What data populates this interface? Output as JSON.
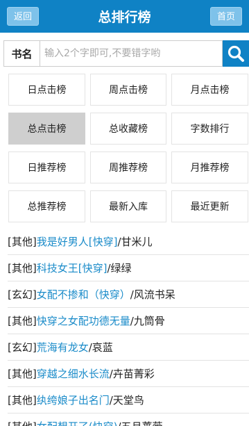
{
  "header": {
    "back_label": "返回",
    "title": "总排行榜",
    "home_label": "首页"
  },
  "search": {
    "label": "书名",
    "placeholder": "输入2个字即可,不要错字哟",
    "button_icon": "search-icon"
  },
  "tabs": [
    {
      "label": "日点击榜",
      "active": false
    },
    {
      "label": "周点击榜",
      "active": false
    },
    {
      "label": "月点击榜",
      "active": false
    },
    {
      "label": "总点击榜",
      "active": true
    },
    {
      "label": "总收藏榜",
      "active": false
    },
    {
      "label": "字数排行",
      "active": false
    },
    {
      "label": "日推荐榜",
      "active": false
    },
    {
      "label": "周推荐榜",
      "active": false
    },
    {
      "label": "月推荐榜",
      "active": false
    },
    {
      "label": "总推荐榜",
      "active": false
    },
    {
      "label": "最新入库",
      "active": false
    },
    {
      "label": "最近更新",
      "active": false
    }
  ],
  "books": [
    {
      "category": "[其他]",
      "title": "我是好男人[快穿]",
      "author": "甘米儿"
    },
    {
      "category": "[其他]",
      "title": "科技女王[快穿]",
      "author": "绿绿"
    },
    {
      "category": "[玄幻]",
      "title": "女配不掺和（快穿）",
      "author": "风流书呆"
    },
    {
      "category": "[其他]",
      "title": "快穿之女配功德无量",
      "author": "九筒骨"
    },
    {
      "category": "[玄幻]",
      "title": "荒海有龙女",
      "author": "哀蓝"
    },
    {
      "category": "[其他]",
      "title": "穿越之细水长流",
      "author": "卉苗菁彩"
    },
    {
      "category": "[其他]",
      "title": "纨绔娘子出名门",
      "author": "天堂鸟"
    },
    {
      "category": "[其他]",
      "title": "女配想开了(快穿)",
      "author": "五月蔷薇"
    }
  ],
  "colors": {
    "primary": "#0f82c5",
    "link": "#1a8bc9",
    "active_tab": "#cfcfcf"
  }
}
